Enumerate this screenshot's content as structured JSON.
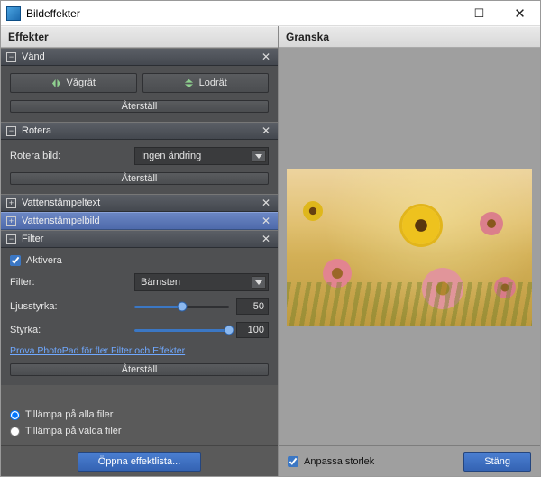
{
  "window": {
    "title": "Bildeffekter"
  },
  "columns": {
    "left_header": "Effekter",
    "right_header": "Granska"
  },
  "flip": {
    "title": "Vänd",
    "horizontal": "Vågrät",
    "vertical": "Lodrät",
    "reset": "Återställ"
  },
  "rotate": {
    "title": "Rotera",
    "label": "Rotera bild:",
    "value": "Ingen ändring",
    "reset": "Återställ"
  },
  "watermark_text": {
    "title": "Vattenstämpeltext"
  },
  "watermark_image": {
    "title": "Vattenstämpelbild"
  },
  "filter": {
    "title": "Filter",
    "enable": "Aktivera",
    "label": "Filter:",
    "value": "Bärnsten",
    "brightness_label": "Ljusstyrka:",
    "brightness_value": "50",
    "strength_label": "Styrka:",
    "strength_value": "100",
    "promo": "Prova PhotoPad för fler Filter och Effekter",
    "reset": "Återställ"
  },
  "apply": {
    "all": "Tillämpa på alla filer",
    "selected": "Tillämpa på valda filer"
  },
  "buttons": {
    "open_list": "Öppna effektlista...",
    "fit": "Anpassa storlek",
    "close": "Stäng"
  }
}
